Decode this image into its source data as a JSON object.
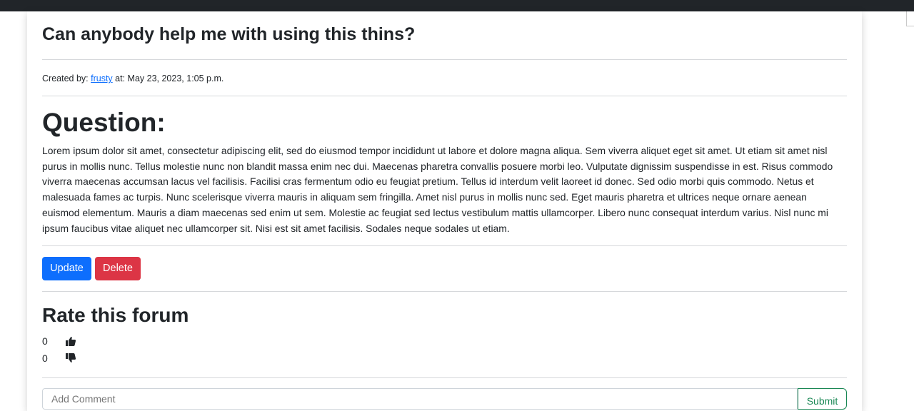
{
  "post": {
    "title": "Can anybody help me with using this thins?",
    "meta": {
      "created_by_label": "Created by:",
      "author": "frusty",
      "at_label": "at:",
      "date": "May 23, 2023, 1:05 p.m."
    },
    "question_heading": "Question:",
    "question_body": "Lorem ipsum dolor sit amet, consectetur adipiscing elit, sed do eiusmod tempor incididunt ut labore et dolore magna aliqua. Sem viverra aliquet eget sit amet. Ut etiam sit amet nisl purus in mollis nunc. Tellus molestie nunc non blandit massa enim nec dui. Maecenas pharetra convallis posuere morbi leo. Vulputate dignissim suspendisse in est. Risus commodo viverra maecenas accumsan lacus vel facilisis. Facilisi cras fermentum odio eu feugiat pretium. Tellus id interdum velit laoreet id donec. Sed odio morbi quis commodo. Netus et malesuada fames ac turpis. Nunc scelerisque viverra mauris in aliquam sem fringilla. Amet nisl purus in mollis nunc sed. Eget mauris pharetra et ultrices neque ornare aenean euismod elementum. Mauris a diam maecenas sed enim ut sem. Molestie ac feugiat sed lectus vestibulum mattis ullamcorper. Libero nunc consequat interdum varius. Nisl nunc mi ipsum faucibus vitae aliquet nec ullamcorper sit. Nisi est sit amet facilisis. Sodales neque sodales ut etiam."
  },
  "actions": {
    "update_label": "Update",
    "delete_label": "Delete"
  },
  "rating": {
    "heading": "Rate this forum",
    "likes": "0",
    "dislikes": "0",
    "like_icon": "thumbs-up-icon",
    "dislike_icon": "thumbs-down-icon"
  },
  "comment": {
    "placeholder": "Add Comment",
    "submit_label": "Submit"
  },
  "colors": {
    "primary": "#0d6efd",
    "danger": "#dc3545",
    "success": "#198754",
    "navbar": "#212529"
  }
}
